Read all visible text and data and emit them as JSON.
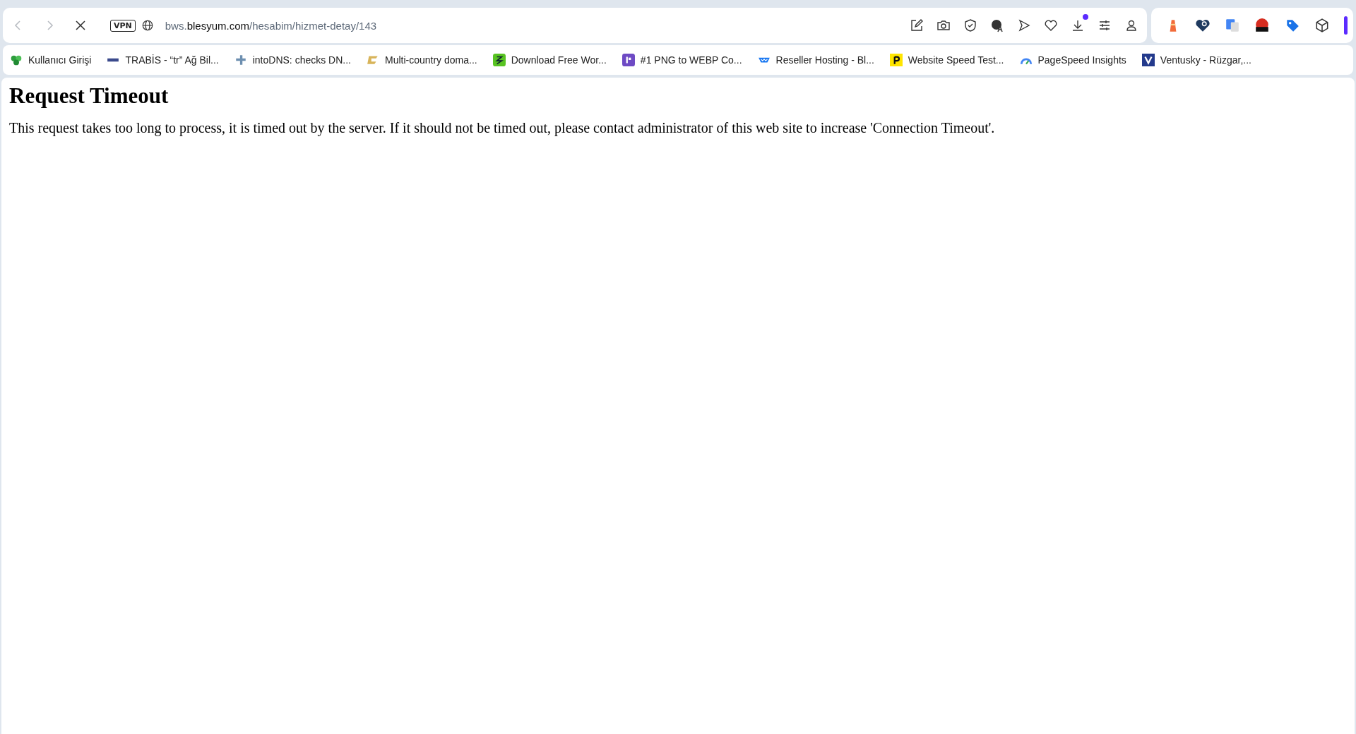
{
  "toolbar": {
    "loading": true,
    "vpn_badge": "VPN",
    "address": {
      "prefix": "bws.",
      "domain": "blesyum.com",
      "path": "/hesabim/hizmet-detay/143"
    },
    "download_badge": true
  },
  "bookmarks": [
    {
      "label": "Kullanıcı Girişi",
      "kind": "leaf"
    },
    {
      "label": "TRABİS - “tr” Ağ Bil...",
      "kind": "wordmark"
    },
    {
      "label": "intoDNS: checks DN...",
      "kind": "puzzle"
    },
    {
      "label": "Multi-country doma...",
      "kind": "c"
    },
    {
      "label": "Download Free Wor...",
      "kind": "zig"
    },
    {
      "label": "#1 PNG to WEBP Co...",
      "kind": "pin"
    },
    {
      "label": "Reseller Hosting - Bl...",
      "kind": "wave"
    },
    {
      "label": "Website Speed Test...",
      "kind": "p"
    },
    {
      "label": "PageSpeed Insights",
      "kind": "gauge"
    },
    {
      "label": "Ventusky - Rüzgar,...",
      "kind": "v"
    }
  ],
  "page": {
    "heading": "Request Timeout",
    "message": "This request takes too long to process, it is timed out by the server. If it should not be timed out, please contact administrator of this web site to increase 'Connection Timeout'."
  }
}
